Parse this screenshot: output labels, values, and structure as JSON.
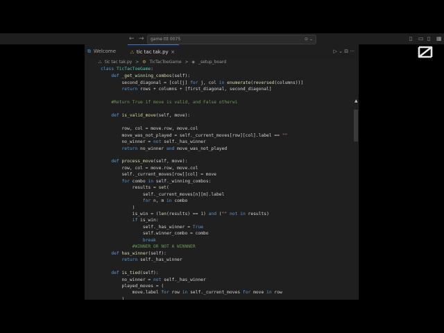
{
  "titlebar": {
    "back_glyph": "←",
    "forward_glyph": "→",
    "search_text": "game ttt 0075",
    "search_icons": "⊙ ⌄"
  },
  "tabs": [
    {
      "label": "Welcome",
      "icon": "vscode-icon"
    },
    {
      "label": "tic tac tak.py",
      "icon": "python-icon"
    }
  ],
  "tab_tools": "▷ ⌄ ⊟ ···",
  "breadcrumb": {
    "file": "tic tac tak.py",
    "class": "TicTacToeGame",
    "method": "_setup_board",
    "sep": ">"
  },
  "code_lines": [
    "    class TicTacToeGame:",
    "        def _get_winning_combos(self):",
    "            second_diagonal = [col[j] for j, col in enumerate(reversed(columns))]",
    "            return rows + columns + [first_diagonal, second_diagonal]",
    "",
    "        #Return True if move is valid, and False otherwi",
    "",
    "        def is_valid_move(self, move):",
    "",
    "            row, col = move.row, move.col",
    "            move_was_not_played = self._current_moves[row][col].label == \"\"",
    "            no_winner = not self._has_winner",
    "            return no_winner and move_was_not_played",
    "",
    "        def process_move(self, move):",
    "            row, col = move.row, move.col",
    "            self._current_moves[row][col] = move",
    "            for combo in self._winning_combos:",
    "                results = set(",
    "                    self._current_moves[n][m].label",
    "                    for n, m in combo",
    "                )",
    "                is_win = (len(results) == 1) and (\"\" not in results)",
    "                if is_win:",
    "                    self._has_winner = True",
    "                    self.winner_combo = combo",
    "                    break",
    "                #WINNER OR NOT A WINNNER",
    "        def has_winner(self):",
    "            return self._has_winner",
    "",
    "        def is_tied(self):",
    "            no_winner = not self._has_winner",
    "            played_moves = (",
    "                move.label for row in self._current_moves for move in row",
    "            )"
  ]
}
